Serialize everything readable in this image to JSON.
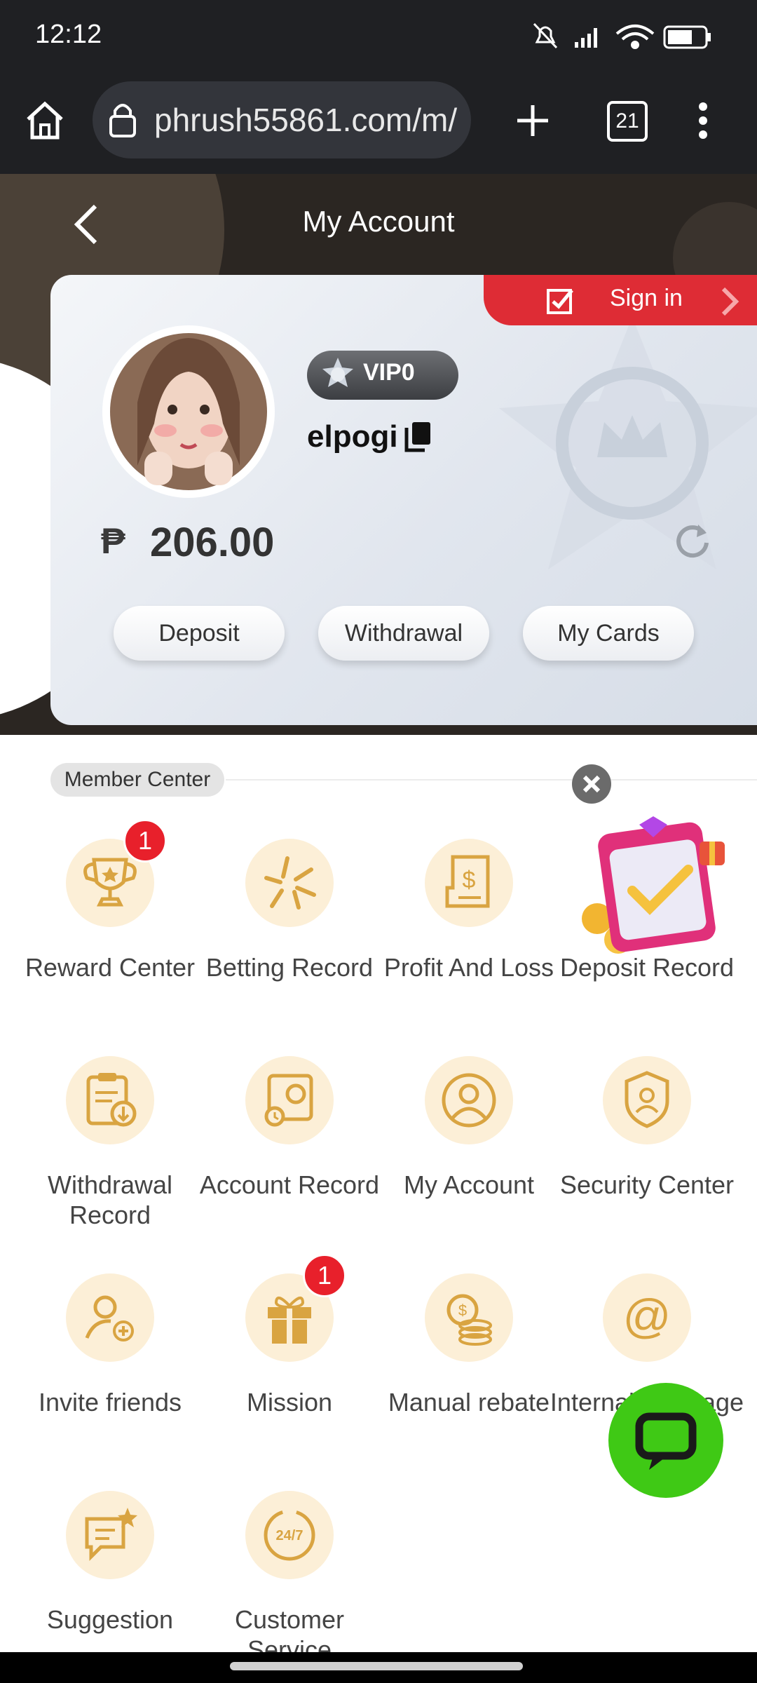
{
  "status": {
    "time": "12:12"
  },
  "browser": {
    "url": "phrush55861.com/m/",
    "tab_count": "21"
  },
  "header": {
    "title": "My Account"
  },
  "account": {
    "signin_label": "Sign in",
    "vip_label": "VIP0",
    "username": "elpogi",
    "currency_symbol": "₱",
    "balance": "206.00",
    "buttons": [
      "Deposit",
      "Withdrawal",
      "My Cards"
    ]
  },
  "member_center": {
    "title": "Member Center",
    "items": [
      {
        "label": "Reward Center",
        "icon": "trophy-icon",
        "badge": "1"
      },
      {
        "label": "Betting Record",
        "icon": "betting-icon"
      },
      {
        "label": "Profit And Loss",
        "icon": "receipt-icon"
      },
      {
        "label": "Deposit Record",
        "icon": "deposit-icon"
      },
      {
        "label": "Withdrawal Record",
        "icon": "clipboard-download-icon"
      },
      {
        "label": "Account Record",
        "icon": "account-record-icon"
      },
      {
        "label": "My Account",
        "icon": "user-icon"
      },
      {
        "label": "Security Center",
        "icon": "shield-user-icon"
      },
      {
        "label": "Invite friends",
        "icon": "invite-icon"
      },
      {
        "label": "Mission",
        "icon": "gift-icon",
        "badge": "1"
      },
      {
        "label": "Manual rebate",
        "icon": "coins-icon"
      },
      {
        "label": "Internal Message",
        "icon": "at-icon"
      },
      {
        "label": "Suggestion",
        "icon": "suggestion-icon"
      },
      {
        "label": "Customer Service",
        "icon": "support-247-icon"
      }
    ]
  },
  "colors": {
    "accent": "#d9a441",
    "icon_bg": "#fcefd7",
    "signin": "#de2c35",
    "chat": "#3fc915"
  }
}
